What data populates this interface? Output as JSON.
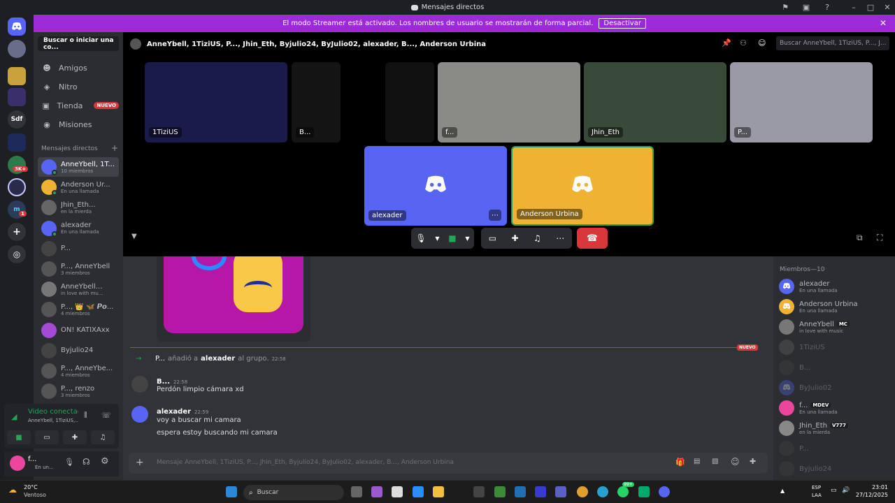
{
  "window": {
    "title": "Mensajes directos"
  },
  "banner": {
    "text": "El modo Streamer está activado. Los nombres de usuario se mostrarán de forma parcial.",
    "button": "Desactivar"
  },
  "servers": [
    "Sdf"
  ],
  "server_badges": [
    "3K+",
    "1"
  ],
  "sidebar": {
    "search": "Buscar o iniciar una co...",
    "nav": [
      {
        "label": "Amigos",
        "icon": "friends-icon"
      },
      {
        "label": "Nitro",
        "icon": "nitro-icon"
      },
      {
        "label": "Tienda",
        "icon": "shop-icon",
        "badge": "NUEVO"
      },
      {
        "label": "Misiones",
        "icon": "quests-icon"
      }
    ],
    "dm_header": "Mensajes directos",
    "dm_add": "+",
    "dms": [
      {
        "name": "AnneYbell, 1T...",
        "sub": "10 miembros",
        "color": "#5865f2",
        "active": true
      },
      {
        "name": "Anderson Ur...",
        "sub": "En una llamada",
        "color": "#f0b232"
      },
      {
        "name": "Jhin_Eth...",
        "sub": "en la mierda",
        "color": "#666"
      },
      {
        "name": "alexader",
        "sub": "En una llamada",
        "color": "#5865f2"
      },
      {
        "name": "P...",
        "sub": "",
        "color": "#444"
      },
      {
        "name": "P..., AnneYbell",
        "sub": "3 miembros",
        "color": "#555"
      },
      {
        "name": "AnneYbell...",
        "sub": "in love with mu...",
        "color": "#777"
      },
      {
        "name": "P..., 👑 🦋 𝙋𝙤...",
        "sub": "4 miembros",
        "color": "#555"
      },
      {
        "name": "ON! KATIXAxx",
        "sub": "",
        "color": "#a44ad6"
      },
      {
        "name": "Byjulio24",
        "sub": "",
        "color": "#444"
      },
      {
        "name": "P..., AnneYbe...",
        "sub": "4 miembros",
        "color": "#555"
      },
      {
        "name": "P..., renzo",
        "sub": "3 miembros",
        "color": "#555"
      }
    ]
  },
  "voice_panel": {
    "status": "Video conectad",
    "channel": "AnneYbell, 1TiziUS,..."
  },
  "user_panel": {
    "name": "f...",
    "status": "En un..."
  },
  "call": {
    "title": "AnneYbell, 1TiziUS, P..., Jhin_Eth, Byjulio24, ByJulio02, alexader, B..., Anderson Urbina",
    "search_placeholder": "Buscar AnneYbell, 1TiziUS, P..., J...",
    "tiles_top": [
      {
        "label": "1TiziUS",
        "bg": "#1a1b4a"
      },
      {
        "label": "B...",
        "bg": "#141414"
      },
      {
        "label": "",
        "bg": "#111"
      },
      {
        "label": "f...",
        "bg": "#8a8a86"
      },
      {
        "label": "Jhin_Eth",
        "bg": "#3a4a3a"
      },
      {
        "label": "P...",
        "bg": "#9a9aa6"
      }
    ],
    "tiles_bottom": [
      {
        "label": "alexader",
        "bg": "#5865f2"
      },
      {
        "label": "Anderson Urbina",
        "bg": "#f0b232"
      }
    ]
  },
  "chat": {
    "divider": "NUEVO",
    "system": {
      "actor": "P...",
      "verb": "añadió a",
      "target": "alexader",
      "tail": "al grupo.",
      "time": "22:58"
    },
    "messages": [
      {
        "author": "B...",
        "time": "22:58",
        "lines": [
          "Perdón limpio cámara xd"
        ]
      },
      {
        "author": "alexader",
        "time": "22:59",
        "lines": [
          "voy a buscar mi camara",
          "espera estoy buscando mi camara"
        ]
      }
    ],
    "input_placeholder": "Mensaje AnneYbell, 1TiziUS, P..., Jhin_Eth, Byjulio24, ByJulio02, alexader, B..., Anderson Urbina"
  },
  "members": {
    "header": "Miembros—10",
    "list": [
      {
        "name": "alexader",
        "sub": "En una llamada",
        "color": "#5865f2",
        "online": true
      },
      {
        "name": "Anderson Urbina",
        "sub": "En una llamada",
        "color": "#f0b232",
        "online": true
      },
      {
        "name": "AnneYbell",
        "tag": "MC",
        "sub": "in love with music",
        "color": "#777",
        "online": true
      },
      {
        "name": "1TiziUS",
        "sub": "",
        "color": "#666",
        "online": false
      },
      {
        "name": "B...",
        "sub": "",
        "color": "#444",
        "online": false
      },
      {
        "name": "ByJulio02",
        "sub": "",
        "color": "#5865f2",
        "online": false
      },
      {
        "name": "f...",
        "tag": "MDEV",
        "sub": "En una llamada",
        "color": "#eb459e",
        "online": true
      },
      {
        "name": "Jhin_Eth",
        "tag": "V777",
        "sub": "en la mierda",
        "color": "#888",
        "online": true
      },
      {
        "name": "P...",
        "sub": "",
        "color": "#444",
        "online": false
      },
      {
        "name": "Byjulio24",
        "sub": "",
        "color": "#444",
        "online": false
      }
    ]
  },
  "taskbar": {
    "weather_temp": "20°C",
    "weather_desc": "Ventoso",
    "search": "Buscar",
    "lang": "ESP",
    "layout": "LAA",
    "time": "23:01",
    "date": "27/12/2025",
    "notif_badge": "99+"
  }
}
